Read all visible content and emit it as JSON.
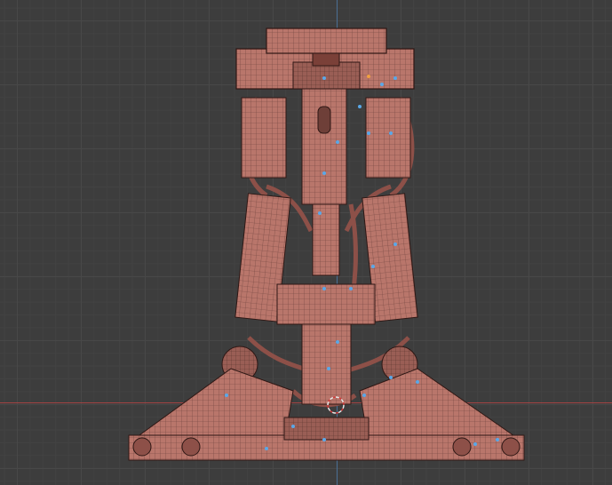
{
  "viewport": {
    "mode": "edit",
    "grid": true,
    "background_color": "#3d3d3d",
    "grid_color": "#484848",
    "x_axis_color": "#a34343",
    "y_axis_color": "#4a6e94"
  },
  "model": {
    "name_icon": "mech-leg-mesh-icon",
    "base_color": "#b9766b",
    "wire_color": "#3a1f1c",
    "shadow_color": "#6e3f38",
    "vertex_color": "#5aa8e8",
    "active_vertex_color": "#f0a040"
  },
  "cursor": {
    "icon": "3d-cursor-icon",
    "outer_color": "#e8e8e8",
    "inner_color": "#d03a3a"
  }
}
